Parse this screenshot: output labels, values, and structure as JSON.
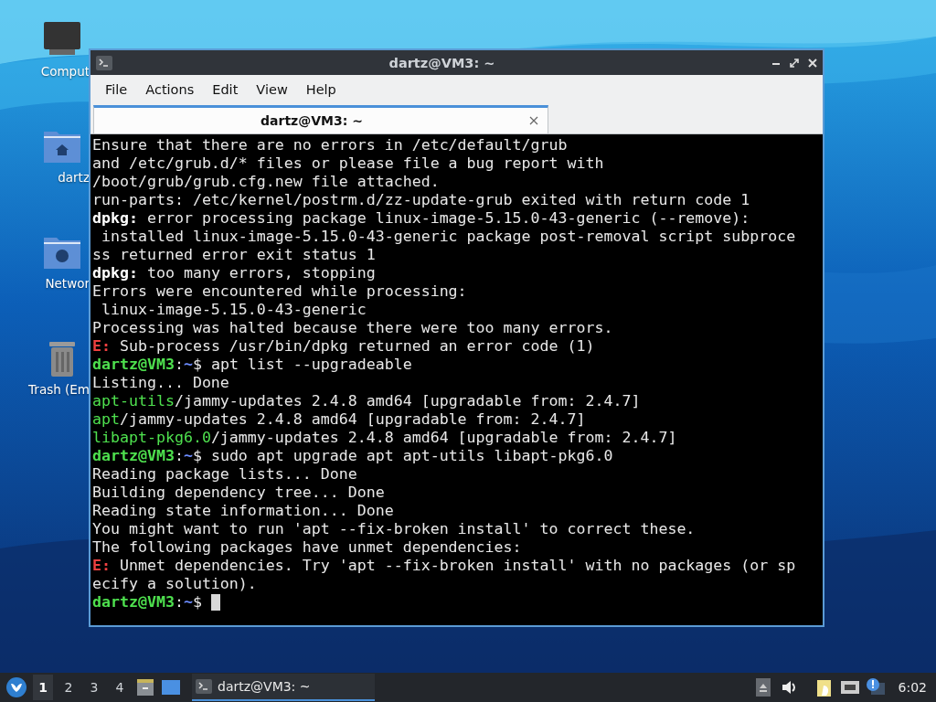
{
  "desktop_icons": [
    {
      "label": "Comput",
      "kind": "computer"
    },
    {
      "label": "dartz",
      "kind": "home"
    },
    {
      "label": "Networ",
      "kind": "network"
    },
    {
      "label": "Trash (Em",
      "kind": "trash"
    }
  ],
  "window": {
    "title": "dartz@VM3: ~",
    "menu": [
      "File",
      "Actions",
      "Edit",
      "View",
      "Help"
    ],
    "tabs": [
      {
        "label": "dartz@VM3: ~",
        "selected": true
      }
    ]
  },
  "terminal": {
    "lines": [
      [
        {
          "text": "Ensure that there are no errors in /etc/default/grub",
          "kind": "plain"
        }
      ],
      [
        {
          "text": "and /etc/grub.d/* files or please file a bug report with",
          "kind": "plain"
        }
      ],
      [
        {
          "text": "/boot/grub/grub.cfg.new file attached.",
          "kind": "plain"
        }
      ],
      [
        {
          "text": "run-parts: /etc/kernel/postrm.d/zz-update-grub exited with return code 1",
          "kind": "plain"
        }
      ],
      [
        {
          "text": "dpkg:",
          "kind": "bold"
        },
        {
          "text": " error processing package linux-image-5.15.0-43-generic (--remove):",
          "kind": "plain"
        }
      ],
      [
        {
          "text": " installed linux-image-5.15.0-43-generic package post-removal script subproce",
          "kind": "plain"
        }
      ],
      [
        {
          "text": "ss returned error exit status 1",
          "kind": "plain"
        }
      ],
      [
        {
          "text": "dpkg:",
          "kind": "bold"
        },
        {
          "text": " too many errors, stopping",
          "kind": "plain"
        }
      ],
      [
        {
          "text": "Errors were encountered while processing:",
          "kind": "plain"
        }
      ],
      [
        {
          "text": " linux-image-5.15.0-43-generic",
          "kind": "plain"
        }
      ],
      [
        {
          "text": "Processing was halted because there were too many errors.",
          "kind": "plain"
        }
      ],
      [
        {
          "text": "E:",
          "kind": "error"
        },
        {
          "text": " Sub-process /usr/bin/dpkg returned an error code (1)",
          "kind": "plain"
        }
      ],
      [
        {
          "text": "dartz@VM3",
          "kind": "user"
        },
        {
          "text": ":",
          "kind": "plain"
        },
        {
          "text": "~",
          "kind": "path"
        },
        {
          "text": "$ apt list --upgradeable",
          "kind": "plain"
        }
      ],
      [
        {
          "text": "Listing... Done",
          "kind": "plain"
        }
      ],
      [
        {
          "text": "apt-utils",
          "kind": "green"
        },
        {
          "text": "/jammy-updates 2.4.8 amd64 [upgradable from: 2.4.7]",
          "kind": "plain"
        }
      ],
      [
        {
          "text": "apt",
          "kind": "green"
        },
        {
          "text": "/jammy-updates 2.4.8 amd64 [upgradable from: 2.4.7]",
          "kind": "plain"
        }
      ],
      [
        {
          "text": "libapt-pkg6.0",
          "kind": "green"
        },
        {
          "text": "/jammy-updates 2.4.8 amd64 [upgradable from: 2.4.7]",
          "kind": "plain"
        }
      ],
      [
        {
          "text": "dartz@VM3",
          "kind": "user"
        },
        {
          "text": ":",
          "kind": "plain"
        },
        {
          "text": "~",
          "kind": "path"
        },
        {
          "text": "$ sudo apt upgrade apt apt-utils libapt-pkg6.0",
          "kind": "plain"
        }
      ],
      [
        {
          "text": "Reading package lists... Done",
          "kind": "plain"
        }
      ],
      [
        {
          "text": "Building dependency tree... Done",
          "kind": "plain"
        }
      ],
      [
        {
          "text": "Reading state information... Done",
          "kind": "plain"
        }
      ],
      [
        {
          "text": "You might want to run 'apt --fix-broken install' to correct these.",
          "kind": "plain"
        }
      ],
      [
        {
          "text": "The following packages have unmet dependencies:",
          "kind": "plain"
        }
      ],
      [
        {
          "text": "E:",
          "kind": "error"
        },
        {
          "text": " Unmet dependencies. Try 'apt --fix-broken install' with no packages (or sp",
          "kind": "plain"
        }
      ],
      [
        {
          "text": "ecify a solution).",
          "kind": "plain"
        }
      ],
      [
        {
          "text": "dartz@VM3",
          "kind": "user"
        },
        {
          "text": ":",
          "kind": "plain"
        },
        {
          "text": "~",
          "kind": "path"
        },
        {
          "text": "$ ",
          "kind": "plain"
        }
      ]
    ]
  },
  "taskbar": {
    "workspaces": [
      {
        "label": "1",
        "selected": true
      },
      {
        "label": "2",
        "selected": false
      },
      {
        "label": "3",
        "selected": false
      },
      {
        "label": "4",
        "selected": false
      }
    ],
    "task": {
      "label": "dartz@VM3: ~",
      "selected": true
    },
    "clock": "6:02"
  }
}
